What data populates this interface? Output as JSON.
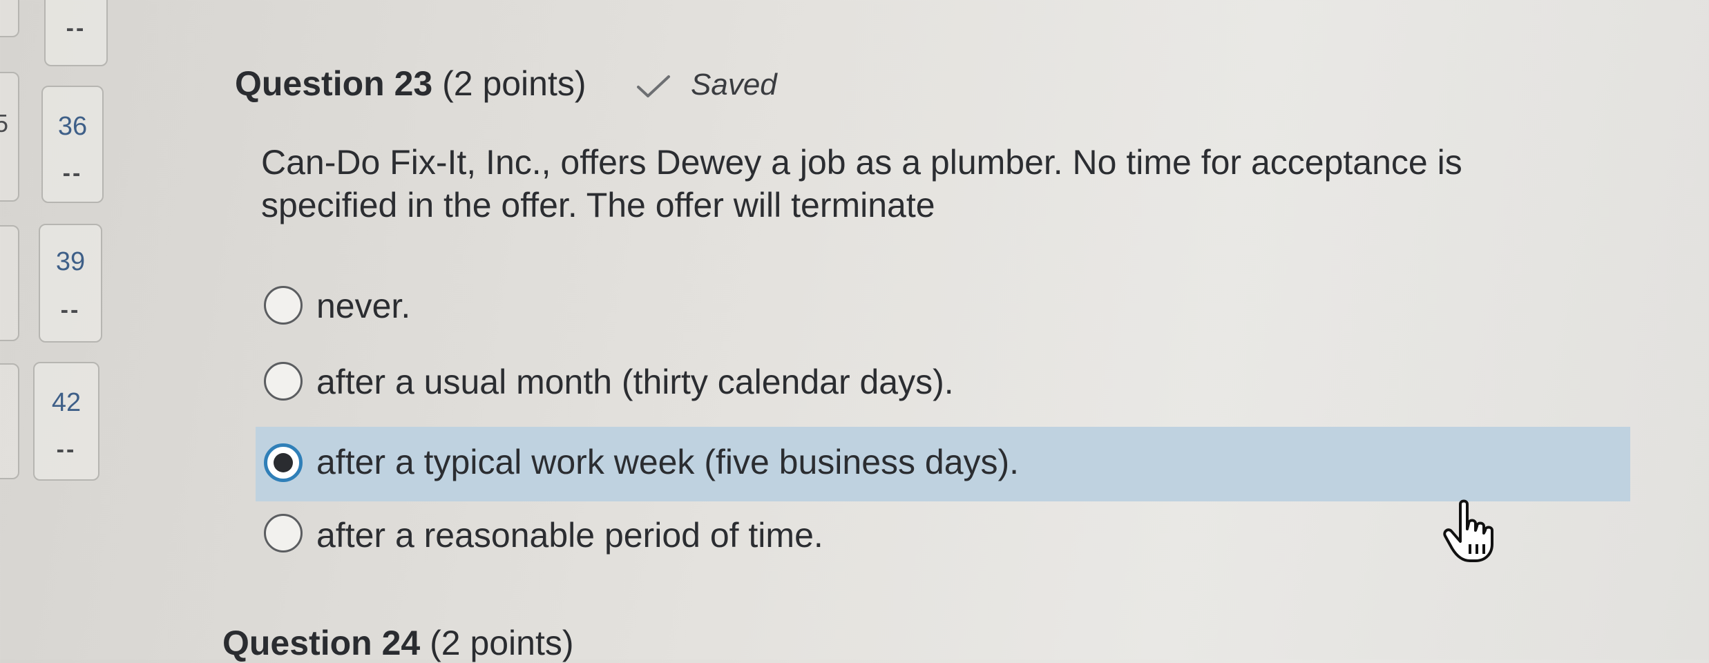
{
  "nav": {
    "tiles": [
      {
        "number": "",
        "status": "--"
      },
      {
        "number": "36",
        "status": "--"
      },
      {
        "number": "39",
        "status": "--"
      },
      {
        "number": "42",
        "status": "--"
      }
    ],
    "edge_numbers": [
      "5"
    ]
  },
  "question": {
    "title": "Question 23",
    "points": "(2 points)",
    "saved_label": "Saved",
    "text": "Can-Do Fix-It, Inc., offers Dewey a job as a plumber. No time for acceptance is specified in the offer. The offer will terminate",
    "options": [
      {
        "label": "never.",
        "selected": false
      },
      {
        "label": "after a usual month (thirty calendar days).",
        "selected": false
      },
      {
        "label": "after a typical work week (five business days).",
        "selected": true
      },
      {
        "label": "after a reasonable period of time.",
        "selected": false
      }
    ]
  },
  "next_question": {
    "title": "Question 24",
    "points": "(2 points)"
  },
  "colors": {
    "selected_bg": "#bfd2e0",
    "radio_ring": "#2f7fb8",
    "nav_number": "#3e5f88"
  }
}
